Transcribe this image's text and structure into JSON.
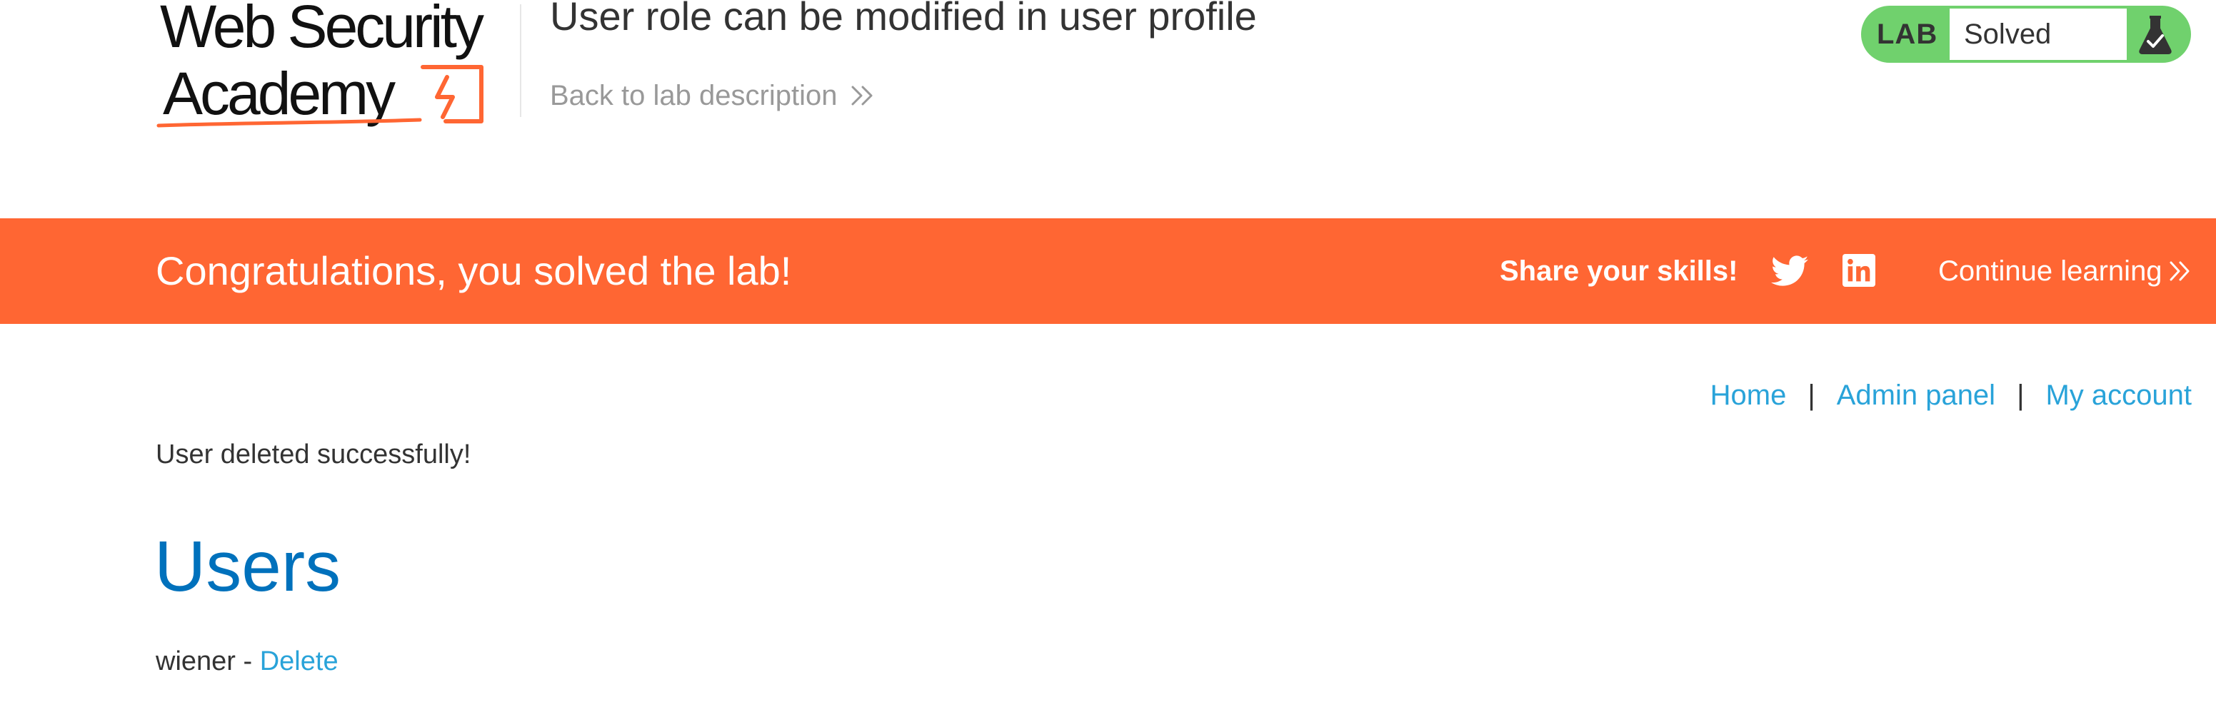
{
  "header": {
    "logo_line1": "Web Security",
    "logo_line2": "Academy",
    "lab_title": "User role can be modified in user profile",
    "back_link": "Back to lab description",
    "lab_badge": "LAB",
    "lab_status": "Solved"
  },
  "banner": {
    "congrats": "Congratulations, you solved the lab!",
    "share": "Share your skills!",
    "continue": "Continue learning",
    "background_color": "#ff6633"
  },
  "nav": {
    "items": [
      {
        "label": "Home"
      },
      {
        "label": "Admin panel"
      },
      {
        "label": "My account"
      }
    ],
    "separator": "|"
  },
  "main": {
    "message": "User deleted successfully!",
    "heading": "Users",
    "users": [
      {
        "name": "wiener",
        "separator": " - ",
        "action": "Delete"
      }
    ]
  },
  "colors": {
    "accent_orange": "#ff6633",
    "status_green": "#70d16d",
    "link_blue": "#29a3d9",
    "heading_blue": "#0071bc"
  },
  "icons": {
    "logo": "web-security-academy-logo",
    "back": "double-chevron-right-icon",
    "status": "flask-icon",
    "share1": "twitter-icon",
    "share2": "linkedin-icon",
    "continue": "double-chevron-right-icon"
  }
}
